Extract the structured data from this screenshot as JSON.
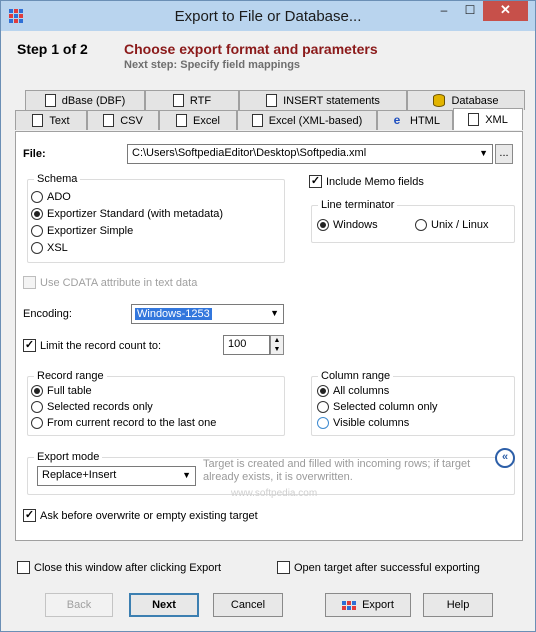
{
  "window": {
    "title": "Export to File or Database...",
    "minimize": "–",
    "maximize": "☐",
    "close": "✕"
  },
  "header": {
    "step": "Step 1 of 2",
    "title": "Choose export format and parameters",
    "next_step": "Next step: Specify field mappings"
  },
  "tabs_row1": [
    {
      "label": "dBase (DBF)",
      "icon": "document-icon"
    },
    {
      "label": "RTF",
      "icon": "document-icon"
    },
    {
      "label": "INSERT statements",
      "icon": "document-icon"
    },
    {
      "label": "Database",
      "icon": "database-icon"
    }
  ],
  "tabs_row2": [
    {
      "label": "Text",
      "icon": "document-icon"
    },
    {
      "label": "CSV",
      "icon": "document-icon"
    },
    {
      "label": "Excel",
      "icon": "document-icon"
    },
    {
      "label": "Excel (XML-based)",
      "icon": "document-icon"
    },
    {
      "label": "HTML",
      "icon": "html-icon",
      "glyph": "e"
    },
    {
      "label": "XML",
      "icon": "xml-icon",
      "active": true
    }
  ],
  "file": {
    "label": "File:",
    "value": "C:\\Users\\SoftpediaEditor\\Desktop\\Softpedia.xml",
    "browse": "..."
  },
  "schema": {
    "label": "Schema",
    "options": [
      {
        "label": "ADO",
        "selected": false
      },
      {
        "label": "Exportizer Standard (with metadata)",
        "selected": true
      },
      {
        "label": "Exportizer Simple",
        "selected": false
      },
      {
        "label": "XSL",
        "selected": false
      }
    ]
  },
  "include_memo": {
    "label": "Include Memo fields",
    "checked": true
  },
  "line_terminator": {
    "label": "Line terminator",
    "options": [
      {
        "label": "Windows",
        "selected": true
      },
      {
        "label": "Unix / Linux",
        "selected": false
      }
    ]
  },
  "cdata": {
    "label": "Use CDATA attribute in text data",
    "checked": false,
    "enabled": false
  },
  "encoding": {
    "label": "Encoding:",
    "value": "Windows-1253"
  },
  "limit": {
    "label": "Limit the record count to:",
    "checked": true,
    "value": "100"
  },
  "record_range": {
    "label": "Record range",
    "options": [
      {
        "label": "Full table",
        "selected": true
      },
      {
        "label": "Selected records only",
        "selected": false
      },
      {
        "label": "From current record to the last one",
        "selected": false
      }
    ]
  },
  "column_range": {
    "label": "Column range",
    "options": [
      {
        "label": "All columns",
        "selected": true
      },
      {
        "label": "Selected column only",
        "selected": false
      },
      {
        "label": "Visible columns",
        "selected": false
      }
    ]
  },
  "export_mode": {
    "label": "Export mode",
    "value": "Replace+Insert",
    "description": "Target is created and filled with incoming rows; if target already exists, it is overwritten."
  },
  "collapse_button": "«",
  "ask_overwrite": {
    "label": "Ask before overwrite or empty existing target",
    "checked": true
  },
  "watermark": "www.softpedia.com",
  "close_after": {
    "label": "Close this window after clicking Export",
    "checked": false
  },
  "open_after": {
    "label": "Open target after successful exporting",
    "checked": false
  },
  "buttons": {
    "back": "Back",
    "next": "Next",
    "cancel": "Cancel",
    "export": "Export",
    "help": "Help"
  }
}
